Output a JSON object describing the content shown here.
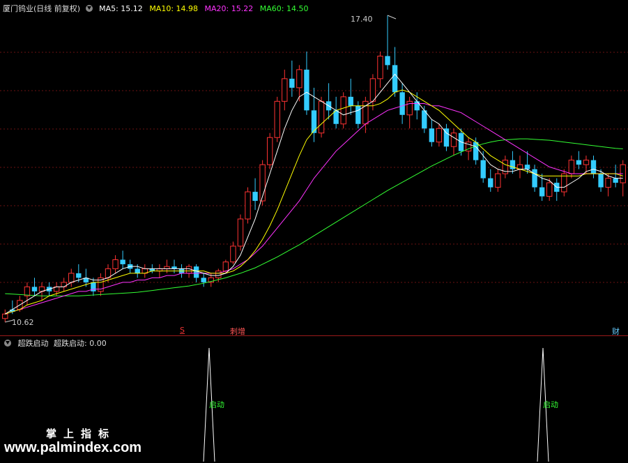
{
  "stock": {
    "title": "厦门钨业(日线 前复权)",
    "ma5_label": "MA5: 15.12",
    "ma10_label": "MA10: 14.98",
    "ma20_label": "MA20: 15.22",
    "ma60_label": "MA60: 14.50",
    "high_label": "17.40",
    "low_label": "10.62",
    "colors": {
      "ma5": "#ffffff",
      "ma10": "#ffff00",
      "ma20": "#ff33ff",
      "ma60": "#33ff33",
      "up": "#ff3333",
      "down": "#33ccff"
    }
  },
  "markers": {
    "s_marker": "S",
    "increase_marker": "增",
    "finance_marker": "财"
  },
  "indicator": {
    "name": "超跌启动",
    "value_label": "超跌启动: 0.00",
    "signal_label_1": "启动",
    "signal_label_2": "启动"
  },
  "watermark": {
    "cn": "掌上指标",
    "url": "www.palmindex.com"
  },
  "chart_data": {
    "type": "candlestick",
    "ylim": [
      10.62,
      17.4
    ],
    "candles": [
      [
        10.7,
        10.9,
        10.62,
        10.8
      ],
      [
        10.9,
        11.1,
        10.8,
        10.85
      ],
      [
        10.9,
        11.2,
        10.85,
        11.1
      ],
      [
        11.2,
        11.5,
        11.0,
        11.4
      ],
      [
        11.4,
        11.6,
        11.2,
        11.3
      ],
      [
        11.3,
        11.5,
        11.1,
        11.4
      ],
      [
        11.4,
        11.5,
        11.2,
        11.3
      ],
      [
        11.3,
        11.5,
        11.2,
        11.4
      ],
      [
        11.4,
        11.6,
        11.3,
        11.5
      ],
      [
        11.5,
        11.8,
        11.4,
        11.7
      ],
      [
        11.7,
        11.9,
        11.5,
        11.6
      ],
      [
        11.6,
        11.8,
        11.4,
        11.5
      ],
      [
        11.5,
        11.6,
        11.2,
        11.3
      ],
      [
        11.3,
        11.7,
        11.2,
        11.6
      ],
      [
        11.6,
        11.9,
        11.5,
        11.8
      ],
      [
        11.8,
        12.1,
        11.7,
        12.0
      ],
      [
        12.0,
        12.2,
        11.8,
        11.9
      ],
      [
        11.9,
        12.0,
        11.7,
        11.8
      ],
      [
        11.8,
        11.9,
        11.6,
        11.7
      ],
      [
        11.7,
        11.9,
        11.6,
        11.8
      ],
      [
        11.8,
        11.9,
        11.7,
        11.75
      ],
      [
        11.75,
        11.9,
        11.6,
        11.8
      ],
      [
        11.8,
        12.0,
        11.7,
        11.85
      ],
      [
        11.85,
        12.0,
        11.7,
        11.8
      ],
      [
        11.8,
        11.9,
        11.6,
        11.7
      ],
      [
        11.7,
        11.9,
        11.6,
        11.85
      ],
      [
        11.85,
        11.9,
        11.5,
        11.6
      ],
      [
        11.6,
        11.7,
        11.4,
        11.5
      ],
      [
        11.5,
        11.7,
        11.4,
        11.6
      ],
      [
        11.6,
        11.8,
        11.5,
        11.75
      ],
      [
        11.75,
        12.0,
        11.7,
        11.95
      ],
      [
        11.95,
        12.4,
        11.9,
        12.3
      ],
      [
        12.3,
        13.0,
        12.2,
        12.9
      ],
      [
        12.9,
        13.6,
        12.8,
        13.5
      ],
      [
        13.5,
        13.8,
        13.1,
        13.3
      ],
      [
        13.3,
        14.2,
        13.2,
        14.1
      ],
      [
        14.1,
        14.8,
        14.0,
        14.7
      ],
      [
        14.7,
        15.6,
        14.6,
        15.5
      ],
      [
        15.5,
        16.2,
        15.3,
        16.0
      ],
      [
        16.0,
        16.4,
        15.6,
        15.8
      ],
      [
        15.8,
        16.3,
        15.5,
        16.2
      ],
      [
        16.2,
        16.6,
        15.2,
        15.3
      ],
      [
        15.3,
        15.8,
        14.6,
        14.8
      ],
      [
        14.8,
        15.6,
        14.7,
        15.5
      ],
      [
        15.5,
        15.9,
        15.1,
        15.3
      ],
      [
        15.3,
        15.6,
        14.9,
        15.0
      ],
      [
        15.0,
        15.7,
        14.9,
        15.6
      ],
      [
        15.6,
        16.0,
        15.2,
        15.4
      ],
      [
        15.4,
        15.5,
        14.9,
        15.0
      ],
      [
        15.0,
        15.6,
        14.8,
        15.5
      ],
      [
        15.5,
        16.1,
        15.3,
        16.0
      ],
      [
        16.0,
        16.6,
        15.8,
        16.5
      ],
      [
        16.5,
        17.4,
        16.2,
        16.3
      ],
      [
        16.3,
        16.7,
        15.6,
        15.7
      ],
      [
        15.7,
        15.9,
        15.0,
        15.2
      ],
      [
        15.2,
        15.6,
        14.9,
        15.5
      ],
      [
        15.5,
        15.7,
        15.1,
        15.3
      ],
      [
        15.3,
        15.4,
        14.8,
        14.9
      ],
      [
        14.9,
        15.1,
        14.5,
        14.6
      ],
      [
        14.6,
        15.0,
        14.5,
        14.9
      ],
      [
        14.9,
        15.0,
        14.4,
        14.5
      ],
      [
        14.5,
        14.9,
        14.3,
        14.8
      ],
      [
        14.8,
        14.9,
        14.3,
        14.4
      ],
      [
        14.4,
        14.7,
        14.2,
        14.6
      ],
      [
        14.6,
        14.7,
        14.1,
        14.2
      ],
      [
        14.2,
        14.4,
        13.7,
        13.8
      ],
      [
        13.8,
        14.0,
        13.5,
        13.6
      ],
      [
        13.6,
        14.0,
        13.5,
        13.9
      ],
      [
        13.9,
        14.3,
        13.8,
        14.2
      ],
      [
        14.2,
        14.4,
        13.9,
        14.0
      ],
      [
        14.0,
        14.3,
        13.8,
        14.1
      ],
      [
        14.1,
        14.4,
        13.9,
        14.0
      ],
      [
        14.0,
        14.1,
        13.5,
        13.6
      ],
      [
        13.6,
        13.9,
        13.3,
        13.4
      ],
      [
        13.4,
        13.8,
        13.3,
        13.7
      ],
      [
        13.7,
        13.8,
        13.3,
        13.5
      ],
      [
        13.5,
        14.0,
        13.4,
        13.9
      ],
      [
        13.9,
        14.3,
        13.8,
        14.2
      ],
      [
        14.2,
        14.4,
        14.0,
        14.1
      ],
      [
        14.1,
        14.3,
        13.9,
        14.2
      ],
      [
        14.2,
        14.3,
        13.8,
        13.9
      ],
      [
        13.9,
        14.0,
        13.5,
        13.6
      ],
      [
        13.6,
        13.9,
        13.4,
        13.8
      ],
      [
        13.8,
        14.1,
        13.6,
        13.7
      ],
      [
        13.7,
        14.2,
        13.4,
        14.1
      ]
    ],
    "ma5": [
      10.8,
      10.9,
      11.0,
      11.1,
      11.2,
      11.3,
      11.35,
      11.4,
      11.4,
      11.5,
      11.55,
      11.6,
      11.55,
      11.55,
      11.6,
      11.7,
      11.8,
      11.85,
      11.85,
      11.8,
      11.8,
      11.8,
      11.8,
      11.8,
      11.8,
      11.8,
      11.75,
      11.7,
      11.65,
      11.65,
      11.7,
      11.85,
      12.1,
      12.5,
      12.9,
      13.4,
      13.9,
      14.4,
      14.9,
      15.3,
      15.6,
      15.7,
      15.6,
      15.5,
      15.4,
      15.3,
      15.2,
      15.25,
      15.3,
      15.4,
      15.5,
      15.7,
      15.9,
      16.1,
      15.9,
      15.7,
      15.5,
      15.3,
      15.1,
      15.0,
      14.8,
      14.7,
      14.6,
      14.55,
      14.5,
      14.3,
      14.1,
      14.0,
      13.95,
      13.95,
      14.0,
      14.0,
      13.9,
      13.8,
      13.75,
      13.6,
      13.6,
      13.7,
      13.8,
      13.95,
      14.0,
      13.95,
      13.85,
      13.8,
      13.8
    ],
    "ma10": [
      10.8,
      10.85,
      10.9,
      11.0,
      11.05,
      11.1,
      11.2,
      11.25,
      11.3,
      11.35,
      11.4,
      11.45,
      11.5,
      11.5,
      11.55,
      11.6,
      11.65,
      11.7,
      11.7,
      11.7,
      11.75,
      11.75,
      11.75,
      11.75,
      11.75,
      11.75,
      11.75,
      11.75,
      11.7,
      11.7,
      11.7,
      11.75,
      11.85,
      12.0,
      12.2,
      12.45,
      12.75,
      13.1,
      13.5,
      13.9,
      14.3,
      14.65,
      14.85,
      15.0,
      15.15,
      15.3,
      15.35,
      15.4,
      15.4,
      15.4,
      15.4,
      15.45,
      15.55,
      15.7,
      15.75,
      15.7,
      15.6,
      15.5,
      15.4,
      15.3,
      15.15,
      15.0,
      14.85,
      14.7,
      14.6,
      14.45,
      14.3,
      14.2,
      14.1,
      14.05,
      14.0,
      13.95,
      13.9,
      13.85,
      13.85,
      13.85,
      13.85,
      13.85,
      13.85,
      13.9,
      13.9,
      13.9,
      13.9,
      13.9,
      13.85
    ],
    "ma20": [
      10.8,
      10.85,
      10.9,
      10.95,
      11.0,
      11.05,
      11.1,
      11.15,
      11.2,
      11.25,
      11.3,
      11.3,
      11.35,
      11.35,
      11.4,
      11.45,
      11.5,
      11.5,
      11.55,
      11.55,
      11.6,
      11.6,
      11.65,
      11.65,
      11.7,
      11.7,
      11.7,
      11.7,
      11.7,
      11.7,
      11.75,
      11.8,
      11.9,
      12.0,
      12.15,
      12.3,
      12.5,
      12.7,
      12.9,
      13.1,
      13.3,
      13.55,
      13.8,
      14.0,
      14.2,
      14.4,
      14.55,
      14.7,
      14.85,
      15.0,
      15.1,
      15.2,
      15.3,
      15.35,
      15.4,
      15.45,
      15.45,
      15.45,
      15.4,
      15.4,
      15.35,
      15.3,
      15.25,
      15.15,
      15.05,
      14.95,
      14.85,
      14.75,
      14.65,
      14.55,
      14.45,
      14.35,
      14.25,
      14.15,
      14.05,
      14.0,
      13.95,
      13.9,
      13.9,
      13.9,
      13.9,
      13.9,
      13.9,
      13.9,
      13.9
    ],
    "ma60": [
      11.25,
      11.24,
      11.23,
      11.22,
      11.21,
      11.2,
      11.2,
      11.2,
      11.2,
      11.2,
      11.2,
      11.21,
      11.22,
      11.23,
      11.24,
      11.25,
      11.26,
      11.27,
      11.28,
      11.3,
      11.32,
      11.34,
      11.36,
      11.38,
      11.4,
      11.42,
      11.45,
      11.48,
      11.52,
      11.56,
      11.6,
      11.65,
      11.7,
      11.76,
      11.82,
      11.9,
      11.98,
      12.06,
      12.15,
      12.24,
      12.33,
      12.43,
      12.53,
      12.63,
      12.73,
      12.83,
      12.93,
      13.03,
      13.13,
      13.23,
      13.33,
      13.43,
      13.53,
      13.62,
      13.71,
      13.8,
      13.89,
      13.98,
      14.07,
      14.15,
      14.23,
      14.31,
      14.38,
      14.45,
      14.51,
      14.56,
      14.6,
      14.63,
      14.65,
      14.66,
      14.67,
      14.67,
      14.66,
      14.65,
      14.64,
      14.62,
      14.6,
      14.58,
      14.56,
      14.54,
      14.52,
      14.5,
      14.48,
      14.46,
      14.45
    ]
  }
}
